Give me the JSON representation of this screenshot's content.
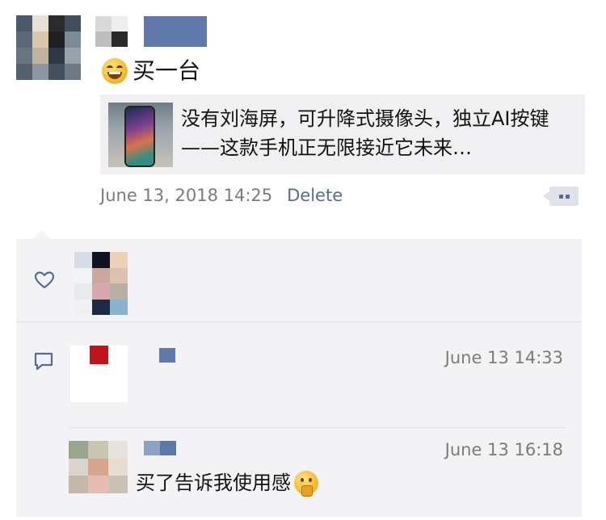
{
  "post": {
    "text": "买一台",
    "emoji": "grinning-squinting-face",
    "link": {
      "title": "没有刘海屏，可升降式摄像头，独立AI按键——这款手机正无限接近它未来…",
      "thumbnail": "phone-photo"
    },
    "timestamp": "June 13, 2018 14:25",
    "delete_label": "Delete"
  },
  "avatar_colors": [
    "#4a5a6c",
    "#e8e0d2",
    "#2b2b2b",
    "#3f4d5c",
    "#5b6877",
    "#d8c9a6",
    "#1f1f24",
    "#7d8a96",
    "#6a7480",
    "#bfb39c",
    "#303844",
    "#98a2ab",
    "#55606e",
    "#8c97a3",
    "#44505f",
    "#6d7884"
  ],
  "name_colors": [
    "#d9d9d9",
    "#eeeeee",
    "#bdbdbd",
    "#2a2a2a"
  ],
  "like_avatar_colors": [
    "#d7dde6",
    "#111320",
    "#eed2b7",
    "#f3f4f7",
    "#c9a8a0",
    "#dcc3b1",
    "#e9eaee",
    "#d8a8b0",
    "#b8aea6",
    "#f0f0f2",
    "#1c2a44",
    "#87b4cf"
  ],
  "comments": [
    {
      "time": "June 13 14:33",
      "avatar_colors": [
        "#ffffff",
        "#c0141c",
        "#ffffff",
        "#ffffff",
        "#ffffff",
        "#ffffff",
        "#ffffff",
        "#ffffff",
        "#ffffff"
      ]
    },
    {
      "time": "June 13 16:18",
      "text": "买了告诉我使用感",
      "emoji": "thinking-face",
      "avatar_colors": [
        "#9aa58e",
        "#c7c6b0",
        "#e6e4dc",
        "#d9d6cf",
        "#d7a58f",
        "#e8dcd0",
        "#c5b8ab",
        "#e5bdb5",
        "#c9c1b8"
      ]
    }
  ],
  "accent_color": "#576b95"
}
